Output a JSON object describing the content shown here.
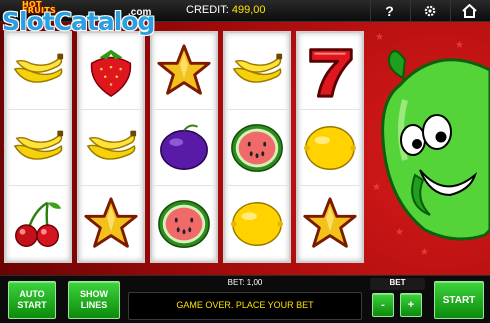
{
  "header": {
    "logo": {
      "hot": "HOT",
      "fruits": "FRUITS",
      "slot": "SlotCatalog",
      "dotcom": ".com"
    },
    "credit_label": "CREDIT:",
    "credit_value": "499,00",
    "icons": [
      "help-icon",
      "settings-icon",
      "home-icon"
    ],
    "help_glyph": "?"
  },
  "reels": [
    [
      "banana",
      "banana",
      "cherry"
    ],
    [
      "strawberry",
      "banana",
      "star"
    ],
    [
      "star",
      "plum",
      "watermelon"
    ],
    [
      "banana",
      "watermelon",
      "lemon"
    ],
    [
      "seven",
      "lemon",
      "star"
    ]
  ],
  "controls": {
    "auto_start_line1": "AUTO",
    "auto_start_line2": "START",
    "show_lines_line1": "SHOW",
    "show_lines_line2": "LINES",
    "bet_label": "BET:",
    "bet_value": "1,00",
    "message": "GAME OVER. PLACE YOUR BET",
    "bet_title": "BET",
    "minus": "-",
    "plus": "+",
    "start": "START"
  },
  "colors": {
    "accent_green": "#1fae1f",
    "credit_yellow": "#ffe300",
    "background_red": "#b30e0e"
  }
}
